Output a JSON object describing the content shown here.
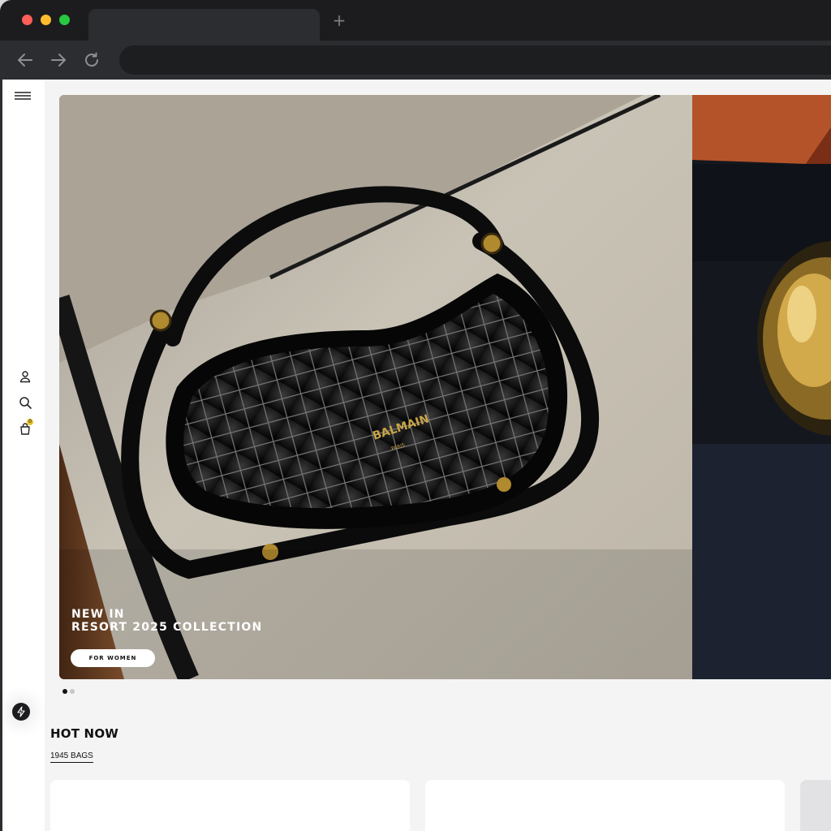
{
  "browser": {
    "new_tab_symbol": "+",
    "icons": [
      "back-arrow-icon",
      "forward-arrow-icon",
      "reload-icon"
    ]
  },
  "sidebar": {
    "icons": [
      "menu-icon",
      "user-icon",
      "search-icon",
      "shopping-bag-icon",
      "lightning-icon"
    ],
    "cart_count": "0",
    "badge_color": "#e8c224"
  },
  "hero": {
    "line1": "NEW IN",
    "line2": "RESORT 2025 COLLECTION",
    "cta_label": "FOR WOMEN",
    "slides_total": 2,
    "active_slide": 1
  },
  "hot_now": {
    "title": "HOT NOW",
    "link_label": "1945 BAGS"
  }
}
